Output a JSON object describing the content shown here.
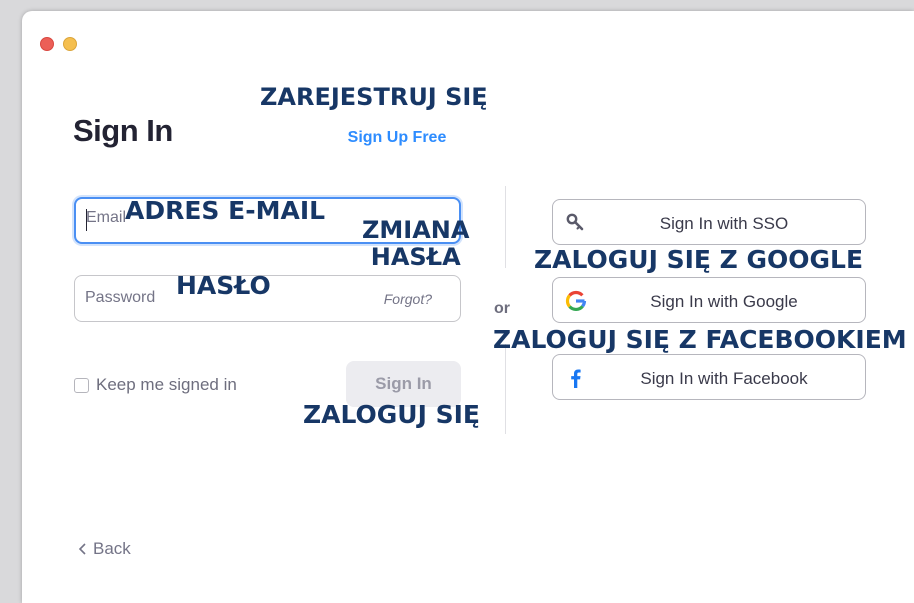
{
  "window": {
    "title": "Sign In",
    "signup_link": "Sign Up Free",
    "email": {
      "placeholder": "Email",
      "value": ""
    },
    "password": {
      "placeholder": "Password",
      "value": ""
    },
    "forgot_link": "Forgot?",
    "keep_signed_in": {
      "label": "Keep me signed in",
      "checked": false
    },
    "signin_button": "Sign In",
    "or_text": "or",
    "social_buttons": [
      {
        "label": "Sign In with SSO",
        "icon": "key-icon"
      },
      {
        "label": "Sign In with Google",
        "icon": "google-icon"
      },
      {
        "label": "Sign In with Facebook",
        "icon": "facebook-icon"
      }
    ],
    "back_link": "Back"
  },
  "annotations": {
    "signup": "ZAREJESTRUJ SIĘ",
    "email": "ADRES E-MAIL",
    "forgot": "ZMIANA\nHASŁA",
    "password": "HASŁO",
    "google": "ZALOGUJ SIĘ Z GOOGLE",
    "facebook": "ZALOGUJ SIĘ Z FACEBOOKIEM",
    "signin": "ZALOGUJ SIĘ"
  },
  "colors": {
    "accent": "#2d8cff",
    "annotation": "#173766",
    "close_button": "#ec5f57",
    "minimize_button": "#f5bf4f",
    "google_blue": "#4285F4",
    "facebook_blue": "#1877F2"
  }
}
